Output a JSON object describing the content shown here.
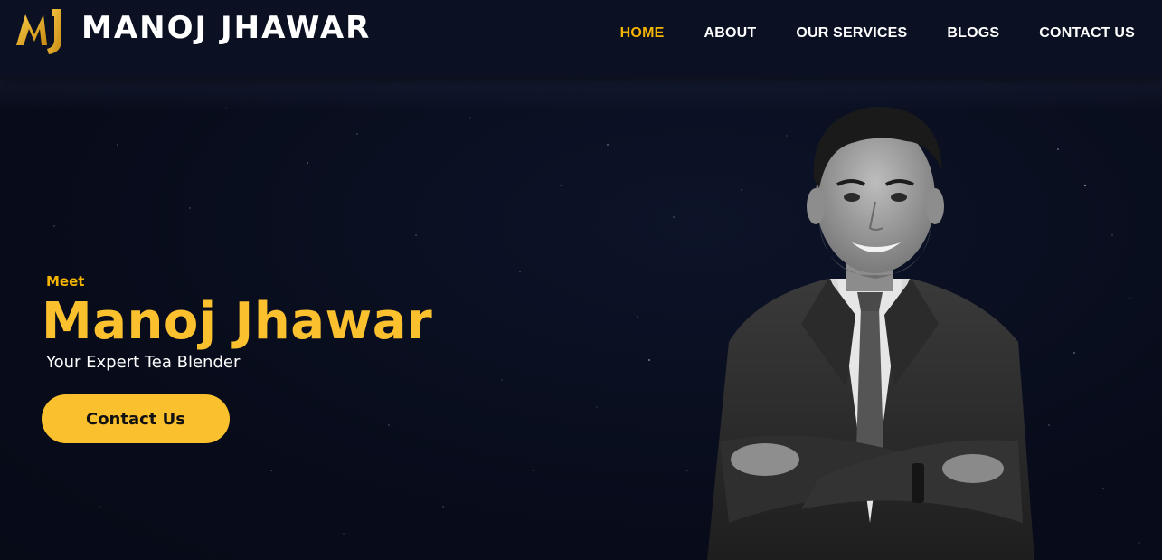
{
  "brand": {
    "name": "MANOJ JHAWAR",
    "logo_letters": "MJ",
    "accent_color": "#f4b400"
  },
  "nav": {
    "items": [
      {
        "label": "HOME",
        "active": true
      },
      {
        "label": "ABOUT",
        "active": false
      },
      {
        "label": "OUR SERVICES",
        "active": false
      },
      {
        "label": "BLOGS",
        "active": false
      },
      {
        "label": "CONTACT US",
        "active": false
      }
    ]
  },
  "hero": {
    "eyebrow": "Meet",
    "name": "Manoj Jhawar",
    "tagline": "Your Expert Tea Blender",
    "cta_label": "Contact Us",
    "portrait_icon": "person-portrait"
  },
  "colors": {
    "background": "#080d1c",
    "header": "#0b1122",
    "accent": "#fbc02d",
    "text": "#ffffff"
  }
}
